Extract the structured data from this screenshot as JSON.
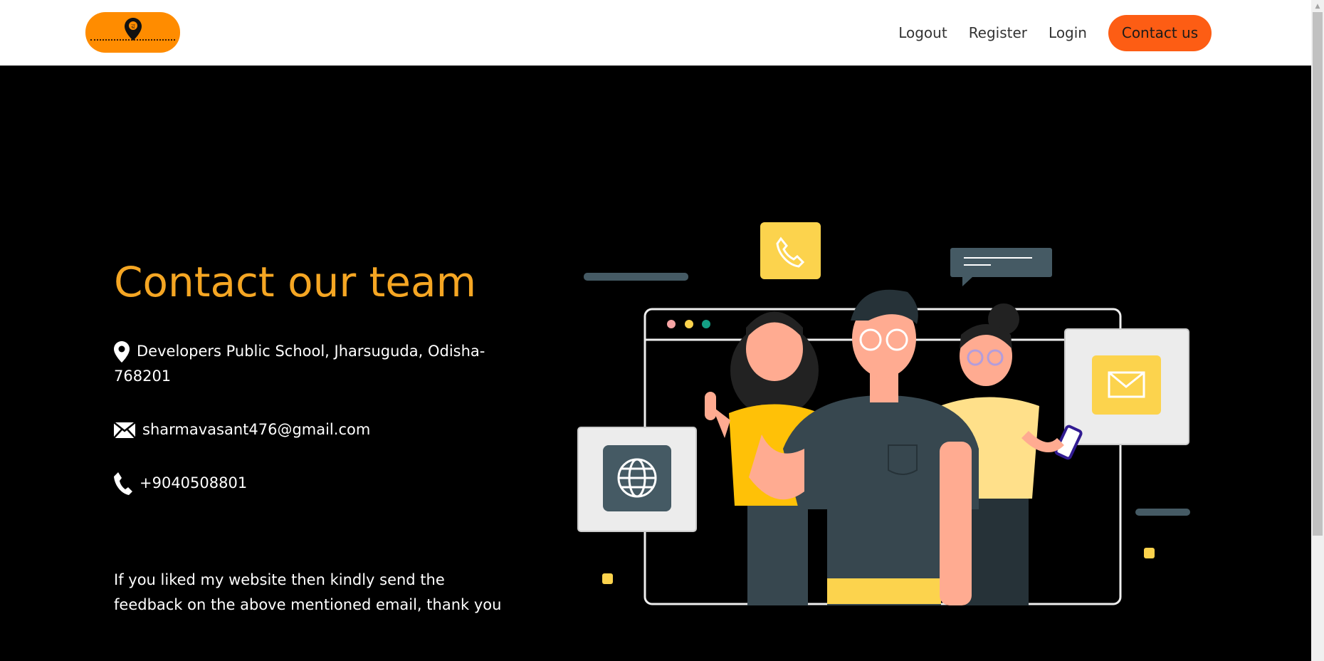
{
  "navbar": {
    "logo_icon": "location-pin-logo",
    "links": [
      {
        "label": "Logout"
      },
      {
        "label": "Register"
      },
      {
        "label": "Login"
      }
    ],
    "contact_button": "Contact us"
  },
  "hero": {
    "title": "Contact our team",
    "address": "Developers Public School, Jharsuguda, Odisha-768201",
    "email": "sharmavasant476@gmail.com",
    "phone": "+9040508801",
    "feedback": "If you liked my website then kindly send the feedback on the above mentioned email, thank you"
  },
  "colors": {
    "accent_orange": "#fd5d14",
    "logo_orange": "#ff8c00",
    "title_orange": "#f5a623",
    "illustration_yellow": "#fcd34d"
  },
  "icons": [
    "location-icon",
    "mail-icon",
    "phone-icon",
    "globe-icon",
    "chat-icon"
  ]
}
